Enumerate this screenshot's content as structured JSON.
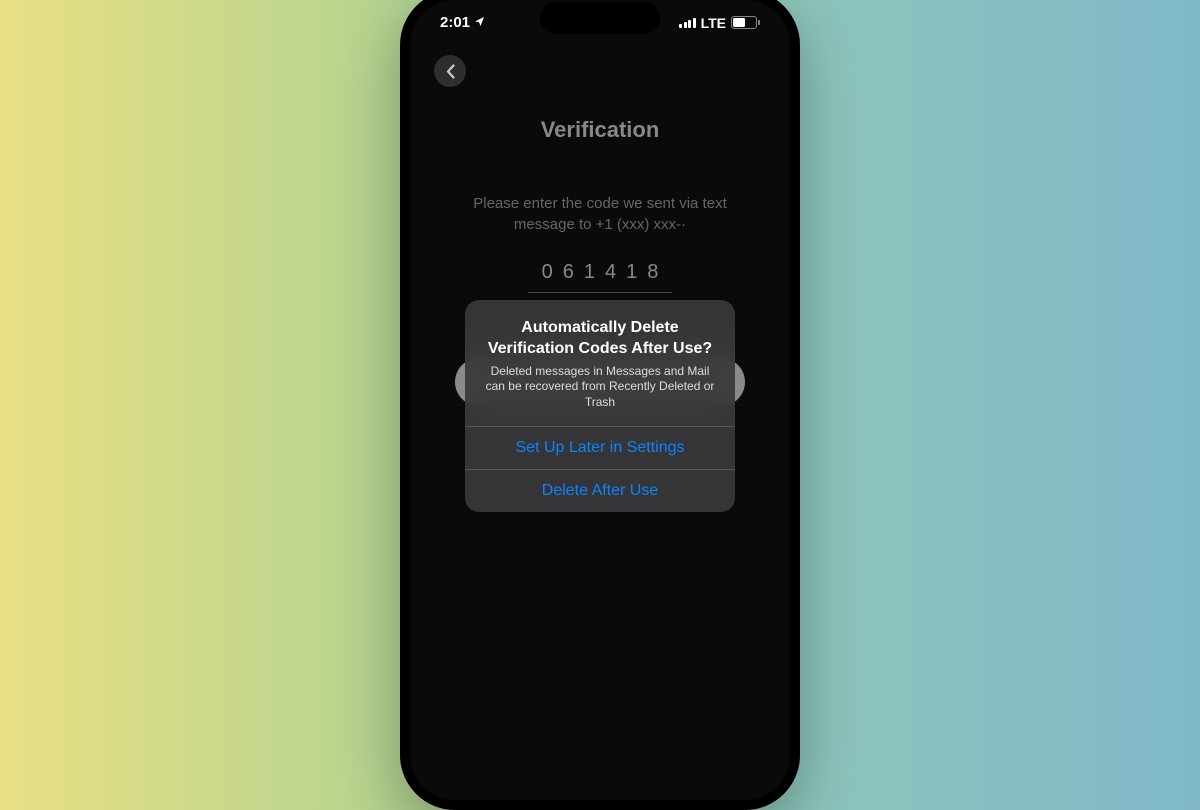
{
  "statusBar": {
    "time": "2:01",
    "network": "LTE",
    "batteryPercent": "48"
  },
  "page": {
    "title": "Verification",
    "instruction": "Please enter the code we sent via text message to +1 (xxx) xxx-·",
    "code": "061418"
  },
  "dialog": {
    "title": "Automatically Delete Verification Codes After Use?",
    "subtitle": "Deleted messages in Messages and Mail can be recovered from Recently Deleted or Trash",
    "button1": "Set Up Later in Settings",
    "button2": "Delete After Use"
  }
}
